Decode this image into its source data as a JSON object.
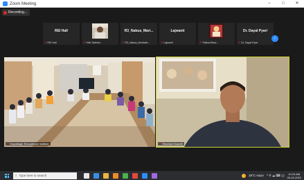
{
  "window": {
    "title": "Zoom Meeting",
    "controls": [
      "–",
      "□",
      "✕"
    ]
  },
  "recording": {
    "label": "Recording..."
  },
  "participants": [
    {
      "name": "REI Hall",
      "caption": "REI Hall",
      "has_video": false
    },
    {
      "name": "",
      "caption": "Hitin Taileshi...",
      "has_video": true
    },
    {
      "name": "R3_Nabua_Mari...",
      "caption": "R3_Nabua_Moribath...",
      "has_video": false
    },
    {
      "name": "Lajwanti",
      "caption": "Lajwanti",
      "has_video": false
    },
    {
      "name": "",
      "caption": "Shiksa Bhav...",
      "has_video": true
    },
    {
      "name": "Dr. Dayal Pyari",
      "caption": "Dr. Dayal Pyari",
      "has_video": false
    }
  ],
  "main_videos": {
    "left": {
      "label": "Dayalbagh Educational Institute"
    },
    "right": {
      "label": "Shankar Murarth"
    }
  },
  "taskbar": {
    "search_placeholder": "Type here to search",
    "weather": "29°C Haze",
    "tray_icons": "^ ⚲ ☁ ⌨ ◫",
    "time": "10:23 AM",
    "date": "26-04-2022",
    "app_colors": [
      "#e8e8e8",
      "#3a8ee6",
      "#f0b43c",
      "#f08a24",
      "#4caf50",
      "#e04a3c",
      "#2d8cff",
      "#9c6ade"
    ]
  },
  "colors": {
    "accent": "#2d8cff",
    "recording": "#e02828",
    "active_speaker": "#c8d232"
  }
}
